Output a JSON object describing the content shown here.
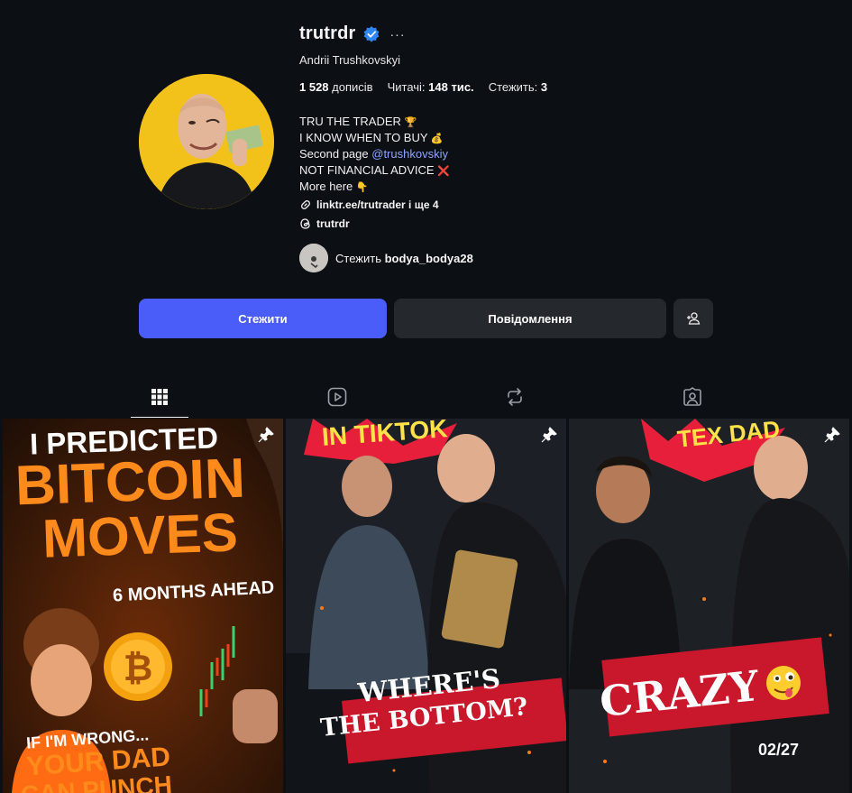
{
  "profile": {
    "username": "trutrdr",
    "more_label": "···",
    "full_name": "Andrii Trushkovskyi",
    "stats": {
      "posts_count": "1 528",
      "posts_label": "дописів",
      "followers_label": "Читачі:",
      "followers_count": "148 тис.",
      "following_label": "Стежить:",
      "following_count": "3"
    },
    "bio": {
      "line1": "TRU THE TRADER",
      "line1_emoji": "🏆",
      "line2": "I KNOW WHEN TO BUY",
      "line2_emoji": "💰",
      "line3_prefix": "Second page",
      "line3_mention": "@trushkovskiy",
      "line4": "NOT FINANCIAL ADVICE",
      "line4_emoji": "❌",
      "line5": "More here",
      "line5_emoji": "👇"
    },
    "link_text": "linktr.ee/trutrader і ще 4",
    "threads_handle": "trutrdr",
    "followed_by_prefix": "Стежить",
    "followed_by_user": "bodya_bodya28"
  },
  "buttons": {
    "follow": "Стежити",
    "message": "Повідомлення"
  },
  "tabs": [
    {
      "name": "posts",
      "icon": "grid-icon",
      "active": true
    },
    {
      "name": "reels",
      "icon": "reels-icon",
      "active": false
    },
    {
      "name": "reposts",
      "icon": "repost-icon",
      "active": false
    },
    {
      "name": "tagged",
      "icon": "tagged-icon",
      "active": false
    }
  ],
  "posts": [
    {
      "pinned": true,
      "text1": "I PREDICTED",
      "text2": "BITCOIN",
      "text3": "MOVES",
      "text4": "6 MONTHS AHEAD",
      "text5": "IF I'M WRONG...",
      "text6": "YOUR DAD",
      "text7": "CAN PUNCH"
    },
    {
      "pinned": true,
      "text_top": "IN TIKTOK",
      "text1": "WHERE'S",
      "text2": "THE BOTTOM?"
    },
    {
      "pinned": true,
      "text_top": "TEX DAD",
      "text1": "CRAZY",
      "text2": "02/27"
    }
  ],
  "colors": {
    "background": "#0c0f14",
    "accent": "#4a5df9",
    "secondary_button": "#25292e",
    "verified": "#2f86f6",
    "mention": "#8fa4ff"
  }
}
